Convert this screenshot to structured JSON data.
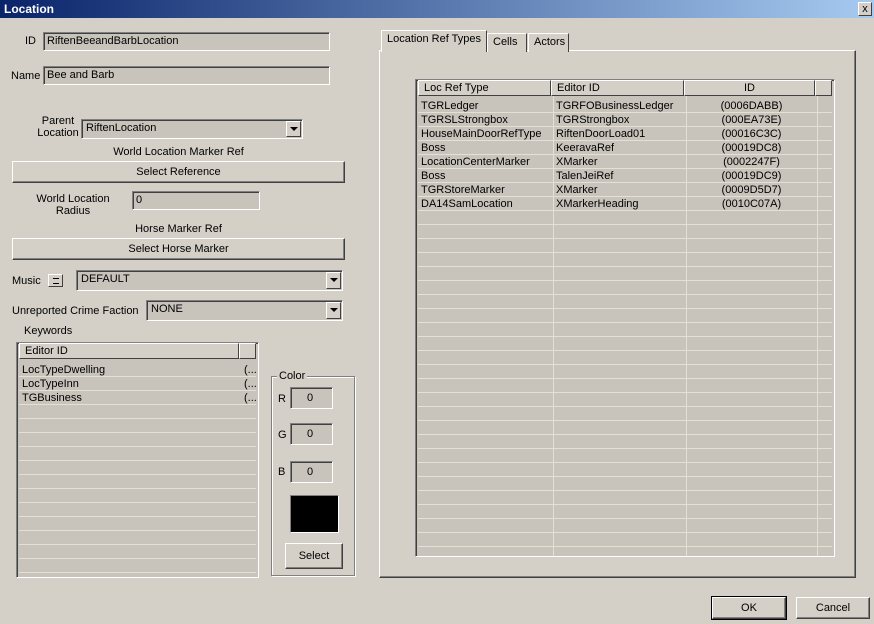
{
  "window": {
    "title": "Location",
    "close_glyph": "x"
  },
  "form": {
    "id_label": "ID",
    "id_value": "RiftenBeeandBarbLocation",
    "name_label": "Name",
    "name_value": "Bee and Barb",
    "parent_location_label_1": "Parent",
    "parent_location_label_2": "Location",
    "parent_location_value": "RiftenLocation",
    "world_marker_label": "World Location Marker Ref",
    "select_reference_label": "Select Reference",
    "world_radius_label_1": "World Location",
    "world_radius_label_2": "Radius",
    "world_radius_value": "0",
    "horse_marker_label": "Horse Marker Ref",
    "select_horse_label": "Select Horse Marker",
    "music_label": "Music",
    "music_value": "DEFAULT",
    "crime_faction_label": "Unreported Crime Faction",
    "crime_faction_value": "NONE"
  },
  "keywords": {
    "label": "Keywords",
    "columns": [
      "Editor ID",
      ""
    ],
    "rows": [
      [
        "LocTypeDwelling",
        "(..."
      ],
      [
        "LocTypeInn",
        "(..."
      ],
      [
        "TGBusiness",
        "(..."
      ]
    ]
  },
  "color": {
    "label": "Color",
    "r_label": "R",
    "r_value": "0",
    "g_label": "G",
    "g_value": "0",
    "b_label": "B",
    "b_value": "0",
    "swatch": "#000000",
    "select_label": "Select"
  },
  "tabs": [
    "Location Ref Types",
    "Cells",
    "Actors"
  ],
  "ref_table": {
    "columns": [
      "Loc Ref Type",
      "Editor ID",
      "ID"
    ],
    "rows": [
      [
        "TGRLedger",
        "TGRFOBusinessLedger",
        "(0006DABB)"
      ],
      [
        "TGRSLStrongbox",
        "TGRStrongbox",
        "(000EA73E)"
      ],
      [
        "HouseMainDoorRefType",
        "RiftenDoorLoad01",
        "(00016C3C)"
      ],
      [
        "Boss",
        "KeeravaRef",
        "(00019DC8)"
      ],
      [
        "LocationCenterMarker",
        "XMarker",
        "(0002247F)"
      ],
      [
        "Boss",
        "TalenJeiRef",
        "(00019DC9)"
      ],
      [
        "TGRStoreMarker",
        "XMarker",
        "(0009D5D7)"
      ],
      [
        "DA14SamLocation",
        "XMarkerHeading",
        "(0010C07A)"
      ]
    ]
  },
  "footer": {
    "ok_label": "OK",
    "cancel_label": "Cancel"
  }
}
